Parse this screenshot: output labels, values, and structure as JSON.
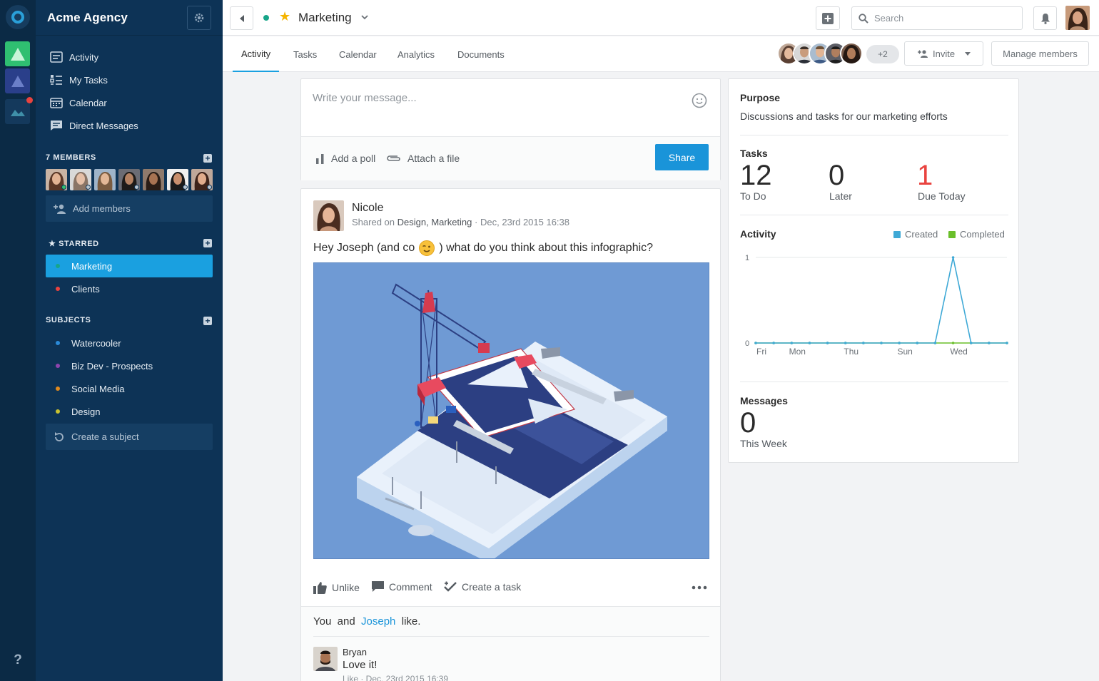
{
  "app": {
    "workspace_name": "Acme Agency",
    "help_label": "?"
  },
  "nav": [
    {
      "label": "Activity",
      "icon": "activity-icon"
    },
    {
      "label": "My Tasks",
      "icon": "tasks-icon"
    },
    {
      "label": "Calendar",
      "icon": "calendar-icon"
    },
    {
      "label": "Direct Messages",
      "icon": "message-icon"
    }
  ],
  "members": {
    "title": "7 MEMBERS",
    "statuses": [
      "online",
      "away",
      "none",
      "away",
      "none",
      "away",
      "away"
    ],
    "add_label": "Add members"
  },
  "starred": {
    "title": "★ STARRED",
    "items": [
      {
        "label": "Marketing",
        "color": "#17a589",
        "active": true
      },
      {
        "label": "Clients",
        "color": "#e9433f",
        "active": false
      }
    ]
  },
  "subjects": {
    "title": "SUBJECTS",
    "items": [
      {
        "label": "Watercooler",
        "color": "#2a8ad8"
      },
      {
        "label": "Biz Dev - Prospects",
        "color": "#8e44ad"
      },
      {
        "label": "Social Media",
        "color": "#e08a1e"
      },
      {
        "label": "Design",
        "color": "#c9c230"
      }
    ],
    "create_label": "Create a subject"
  },
  "topbar": {
    "channel_title": "Marketing",
    "search_placeholder": "Search"
  },
  "tabs": [
    "Activity",
    "Tasks",
    "Calendar",
    "Analytics",
    "Documents"
  ],
  "active_tab": "Activity",
  "team": {
    "extra_count": "+2",
    "invite_label": "Invite",
    "manage_label": "Manage members"
  },
  "composer": {
    "placeholder": "Write your message...",
    "poll_label": "Add a poll",
    "attach_label": "Attach a file",
    "share_label": "Share"
  },
  "post": {
    "author": "Nicole",
    "shared_on": "Shared on",
    "channels": "Design, Marketing",
    "timestamp": "· Dec, 23rd 2015 16:38",
    "text_before": "Hey Joseph (and co",
    "text_after": ") what do you think about this infographic?",
    "unlike_label": "Unlike",
    "comment_label": "Comment",
    "task_label": "Create a task",
    "likes_you": "You",
    "likes_and": "and",
    "likes_name": "Joseph",
    "likes_suffix": "like.",
    "comment": {
      "author": "Bryan",
      "text": "Love it!",
      "meta": "Like · Dec, 23rd 2015 16:39"
    }
  },
  "panel": {
    "purpose_title": "Purpose",
    "purpose_text": "Discussions and tasks for our marketing efforts",
    "tasks_title": "Tasks",
    "stats": [
      {
        "value": "12",
        "label": "To Do",
        "color": "#2b2b2b"
      },
      {
        "value": "0",
        "label": "Later",
        "color": "#2b2b2b"
      },
      {
        "value": "1",
        "label": "Due Today",
        "color": "#e9433f"
      }
    ],
    "activity_title": "Activity",
    "legend_created": "Created",
    "legend_completed": "Completed",
    "messages_title": "Messages",
    "messages_value": "0",
    "messages_label": "This Week"
  },
  "chart_data": {
    "type": "line",
    "x": [
      "Fri",
      "",
      "Mon",
      "",
      "",
      "Thu",
      "",
      "",
      "Sun",
      "",
      "",
      "Wed",
      "",
      "",
      ""
    ],
    "tick_labels": [
      "Fri",
      "Mon",
      "Thu",
      "Sun",
      "Wed"
    ],
    "series": [
      {
        "name": "Created",
        "color": "#3fa9d6",
        "values": [
          0,
          0,
          0,
          0,
          0,
          0,
          0,
          0,
          0,
          0,
          0,
          1,
          0,
          0,
          0
        ]
      },
      {
        "name": "Completed",
        "color": "#6abf2a",
        "values": [
          0,
          0,
          0,
          0,
          0,
          0,
          0,
          0,
          0,
          0,
          0,
          0,
          0,
          0,
          0
        ]
      }
    ],
    "ylim": [
      0,
      1
    ],
    "y_ticks": [
      "0",
      "1"
    ]
  }
}
